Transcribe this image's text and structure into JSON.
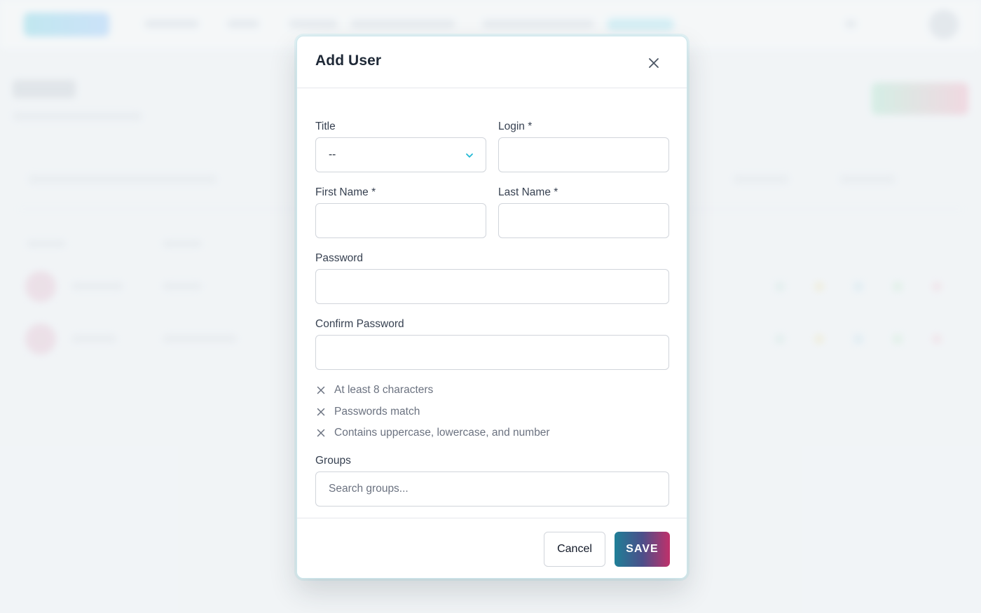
{
  "modal": {
    "title": "Add User",
    "fields": {
      "title": {
        "label": "Title",
        "value": "--"
      },
      "login": {
        "label": "Login *",
        "value": ""
      },
      "first_name": {
        "label": "First Name *",
        "value": ""
      },
      "last_name": {
        "label": "Last Name *",
        "value": ""
      },
      "password": {
        "label": "Password",
        "value": ""
      },
      "confirm_password": {
        "label": "Confirm Password",
        "value": ""
      },
      "groups": {
        "label": "Groups",
        "placeholder": "Search groups..."
      }
    },
    "password_rules": [
      {
        "text": "At least 8 characters",
        "met": false
      },
      {
        "text": "Passwords match",
        "met": false
      },
      {
        "text": "Contains uppercase, lowercase, and number",
        "met": false
      }
    ],
    "footer": {
      "cancel_label": "Cancel",
      "save_label": "SAVE"
    }
  },
  "colors": {
    "accent": "#22b8d4",
    "save_gradient_start": "#1f7f97",
    "save_gradient_end": "#c0306a",
    "rule_unmet": "#6b7280"
  },
  "icons": {
    "close": "close-icon",
    "chevron": "chevron-down-icon",
    "rule_unmet": "x-mark-icon"
  }
}
